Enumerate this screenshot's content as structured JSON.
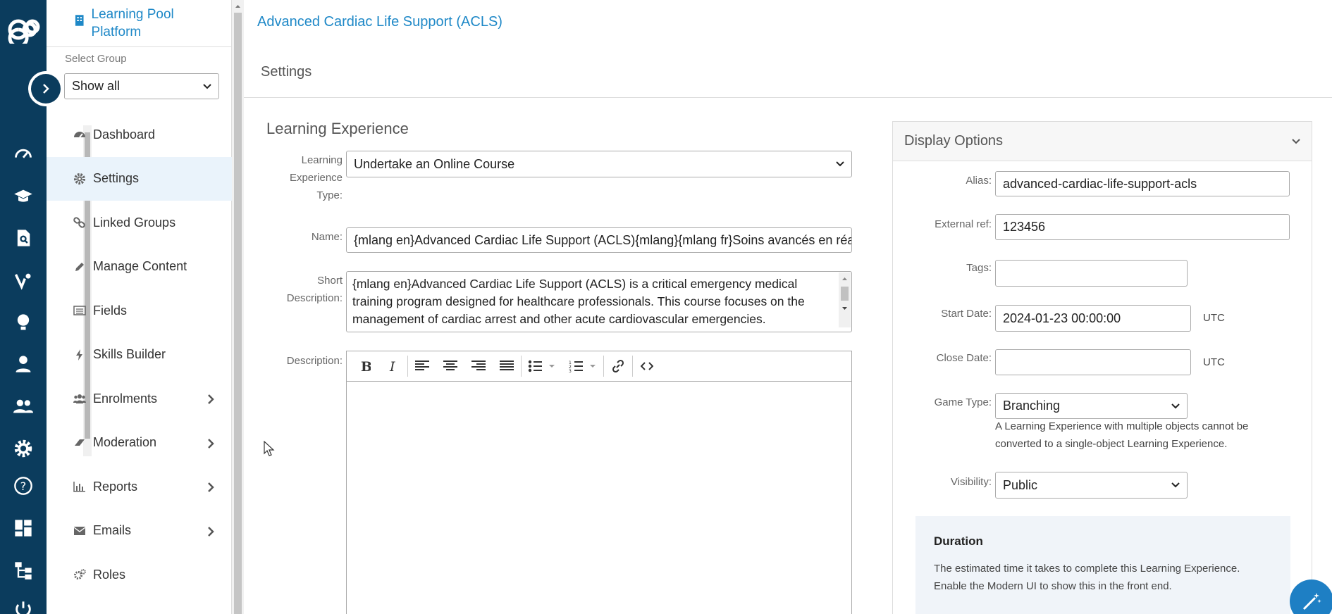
{
  "sidebar": {
    "platform_name": "Learning Pool Platform",
    "group_label": "Select Group",
    "group_value": "Show all",
    "items": [
      {
        "label": "Dashboard",
        "icon": "dashboard-icon"
      },
      {
        "label": "Settings",
        "icon": "gear-icon",
        "active": true
      },
      {
        "label": "Linked Groups",
        "icon": "link-icon"
      },
      {
        "label": "Manage Content",
        "icon": "pencil-icon"
      },
      {
        "label": "Fields",
        "icon": "list-icon"
      },
      {
        "label": "Skills Builder",
        "icon": "bolt-icon"
      },
      {
        "label": "Enrolments",
        "icon": "users-icon",
        "expandable": true
      },
      {
        "label": "Moderation",
        "icon": "eraser-icon",
        "expandable": true
      },
      {
        "label": "Reports",
        "icon": "bar-chart-icon",
        "expandable": true
      },
      {
        "label": "Emails",
        "icon": "envelope-icon",
        "expandable": true
      },
      {
        "label": "Roles",
        "icon": "cogs-icon"
      }
    ]
  },
  "main": {
    "breadcrumb": "Advanced Cardiac Life Support (ACLS)",
    "page_title": "Settings",
    "section_title": "Learning Experience",
    "form": {
      "type_label": "Learning Experience Type:",
      "type_value": "Undertake an Online Course",
      "name_label": "Name:",
      "name_value": "{mlang en}Advanced Cardiac Life Support (ACLS){mlang}{mlang fr}Soins avancés en réan",
      "short_desc_label": "Short Description:",
      "short_desc_value": "{mlang en}Advanced Cardiac Life Support (ACLS) is a critical emergency medical training program designed for healthcare professionals. This course focuses on the management of cardiac arrest and other acute cardiovascular emergencies.",
      "description_label": "Description:"
    }
  },
  "display_options": {
    "title": "Display Options",
    "alias_label": "Alias:",
    "alias_value": "advanced-cardiac-life-support-acls",
    "extref_label": "External ref:",
    "extref_value": "123456",
    "tags_label": "Tags:",
    "tags_value": "",
    "start_label": "Start Date:",
    "start_value": "2024-01-23 00:00:00",
    "close_label": "Close Date:",
    "close_value": "",
    "utc": "UTC",
    "game_type_label": "Game Type:",
    "game_type_value": "Branching",
    "game_type_help": "A Learning Experience with multiple objects cannot be converted to a single-object Learning Experience.",
    "visibility_label": "Visibility:",
    "visibility_value": "Public",
    "duration_title": "Duration",
    "duration_text": "The estimated time it takes to complete this Learning Experience. Enable the Modern UI to show this in the front end."
  },
  "colors": {
    "rail": "#0b3c5d",
    "accent": "#1e88c7",
    "active_bg": "#eaf3fb"
  }
}
